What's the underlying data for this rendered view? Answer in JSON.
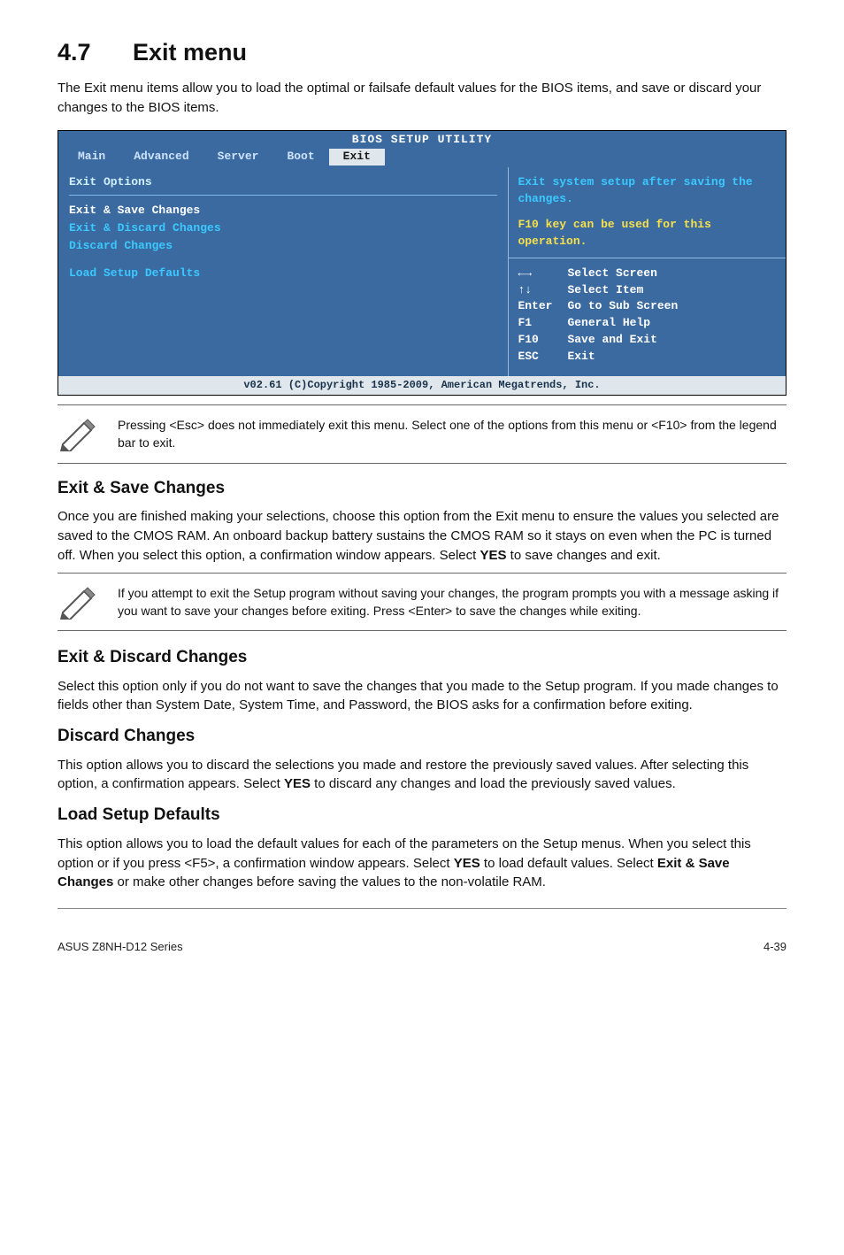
{
  "section": {
    "number": "4.7",
    "title": "Exit menu"
  },
  "intro": "The Exit menu items allow you to load the optimal or failsafe default values for the BIOS items, and save or discard your changes to the BIOS items.",
  "bios": {
    "titlebar": "BIOS SETUP UTILITY",
    "tabs": [
      "Main",
      "Advanced",
      "Server",
      "Boot",
      "Exit"
    ],
    "active_tab": "Exit",
    "left": {
      "heading": "Exit Options",
      "items": [
        {
          "label": "Exit & Save Changes",
          "highlight": true
        },
        {
          "label": "Exit & Discard Changes",
          "highlight": false
        },
        {
          "label": "Discard Changes",
          "highlight": false
        },
        {
          "label": "Load Setup Defaults",
          "highlight": false
        }
      ]
    },
    "help": {
      "line1": "Exit system setup after saving the changes.",
      "line2": "F10 key can be used for this operation."
    },
    "nav": [
      {
        "key": "←→",
        "label": "Select Screen"
      },
      {
        "key": "↑↓",
        "label": "Select Item"
      },
      {
        "key": "Enter",
        "label": "Go to Sub Screen"
      },
      {
        "key": "F1",
        "label": "General Help"
      },
      {
        "key": "F10",
        "label": "Save and Exit"
      },
      {
        "key": "ESC",
        "label": "Exit"
      }
    ],
    "footer": "v02.61 (C)Copyright 1985-2009, American Megatrends, Inc."
  },
  "note1": "Pressing <Esc> does not immediately exit this menu. Select one of the options from this menu or <F10> from the legend bar to exit.",
  "sections": {
    "save": {
      "title": "Exit & Save Changes",
      "body": "Once you are finished making your selections, choose this option from the Exit menu to ensure the values you selected are saved to the CMOS RAM. An onboard backup battery sustains the CMOS RAM so it stays on even when the PC is turned off. When you select this option, a confirmation window appears. Select YES to save changes and exit."
    },
    "note2": "If you attempt to exit the Setup program without saving your changes, the program prompts you with a message asking if you want to save your changes before exiting. Press <Enter> to save the changes while exiting.",
    "discard_exit": {
      "title": "Exit & Discard Changes",
      "body": "Select this option only if you do not want to save the changes that you made to the Setup program. If you made changes to fields other than System Date, System Time, and Password, the BIOS asks for a confirmation before exiting."
    },
    "discard": {
      "title": "Discard Changes",
      "body": "This option allows you to discard the selections you made and restore the previously saved values. After selecting this option, a confirmation appears. Select YES to discard any changes and load the previously saved values."
    },
    "defaults": {
      "title": "Load Setup Defaults",
      "body": "This option allows you to load the default values for each of the parameters on the Setup menus. When you select this option or if you press <F5>, a confirmation window appears. Select YES to load default values. Select Exit & Save Changes or make other changes before saving the values to the non-volatile RAM."
    }
  },
  "footer": {
    "left": "ASUS Z8NH-D12 Series",
    "right": "4-39"
  }
}
